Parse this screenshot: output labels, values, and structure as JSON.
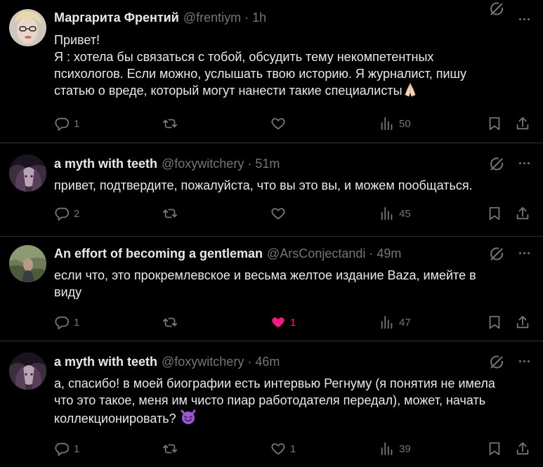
{
  "tweets": [
    {
      "name": "Маргарита Френтий",
      "handle": "@frentiym",
      "time": "1h",
      "lines": [
        "Привет!",
        "Я : хотела бы связаться с тобой, обсудить тему некомпетентных",
        "психологов. Если можно, услышать твою историю. Я журналист, пишу",
        "статью о вреде, который могут нанести такие специалисты"
      ],
      "emoji": "folded-hands",
      "replies": "1",
      "retweets": "",
      "likes": "",
      "views": "50",
      "liked": false
    },
    {
      "name": "a myth with teeth",
      "handle": "@foxywitchery",
      "time": "51m",
      "lines": [
        "привет, подтвердите, пожалуйста, что вы это вы, и можем пообщаться."
      ],
      "replies": "2",
      "retweets": "",
      "likes": "",
      "views": "45",
      "liked": false
    },
    {
      "name": "An effort of becoming a gentleman",
      "handle": "@ArsConjectandi",
      "time": "49m",
      "lines": [
        "если что, это прокремлевское и весьма желтое издание Baza, имейте в",
        "виду"
      ],
      "replies": "1",
      "retweets": "",
      "likes": "1",
      "views": "47",
      "liked": true
    },
    {
      "name": "a myth with teeth",
      "handle": "@foxywitchery",
      "time": "46m",
      "lines": [
        "а, спасибо! в моей биографии есть интервью Регнуму (я понятия не имела",
        "что это такое, меня им чисто пиар работодателя передал), может, начать",
        "коллекционировать?"
      ],
      "emoji": "smiling-devil",
      "replies": "1",
      "retweets": "",
      "likes": "1",
      "views": "39",
      "liked": false
    }
  ],
  "colors": {
    "background": "#000000",
    "text": "#e7e9ea",
    "muted": "#71767b",
    "divider": "#2f3336",
    "like_active": "#f91880"
  },
  "icons": [
    "grok-icon",
    "more-icon",
    "reply-icon",
    "retweet-icon",
    "like-icon",
    "views-icon",
    "bookmark-icon",
    "share-icon"
  ]
}
